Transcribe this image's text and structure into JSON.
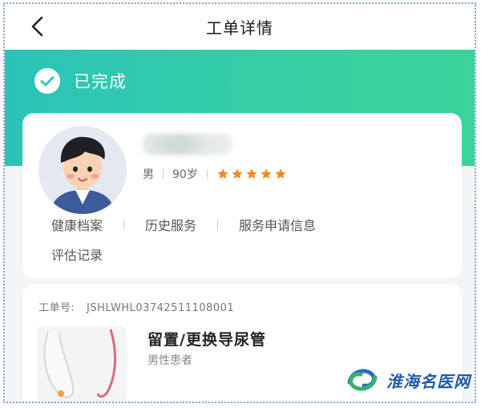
{
  "header": {
    "title": "工单详情",
    "back_icon": "chevron-left-icon"
  },
  "status": {
    "label": "已完成",
    "icon": "check-circle-icon",
    "gradient": [
      "#2bc3b8",
      "#3ad39a"
    ]
  },
  "patient": {
    "gender": "男",
    "age": "90岁",
    "rating_stars": 5,
    "star_color": "#f08a24",
    "avatar": "avatar-cartoon-boy"
  },
  "profile_links": [
    "健康档案",
    "历史服务",
    "服务申请信息",
    "评估记录"
  ],
  "order": {
    "number_label": "工单号:",
    "number": "JSHLWHL03742511108001",
    "service_title": "留置/更换导尿管",
    "service_subtitle": "男性患者",
    "thumbnail": "catheter-image"
  },
  "watermark": {
    "text": "淮海名医网",
    "logo": "blue-green-swirl-logo"
  }
}
